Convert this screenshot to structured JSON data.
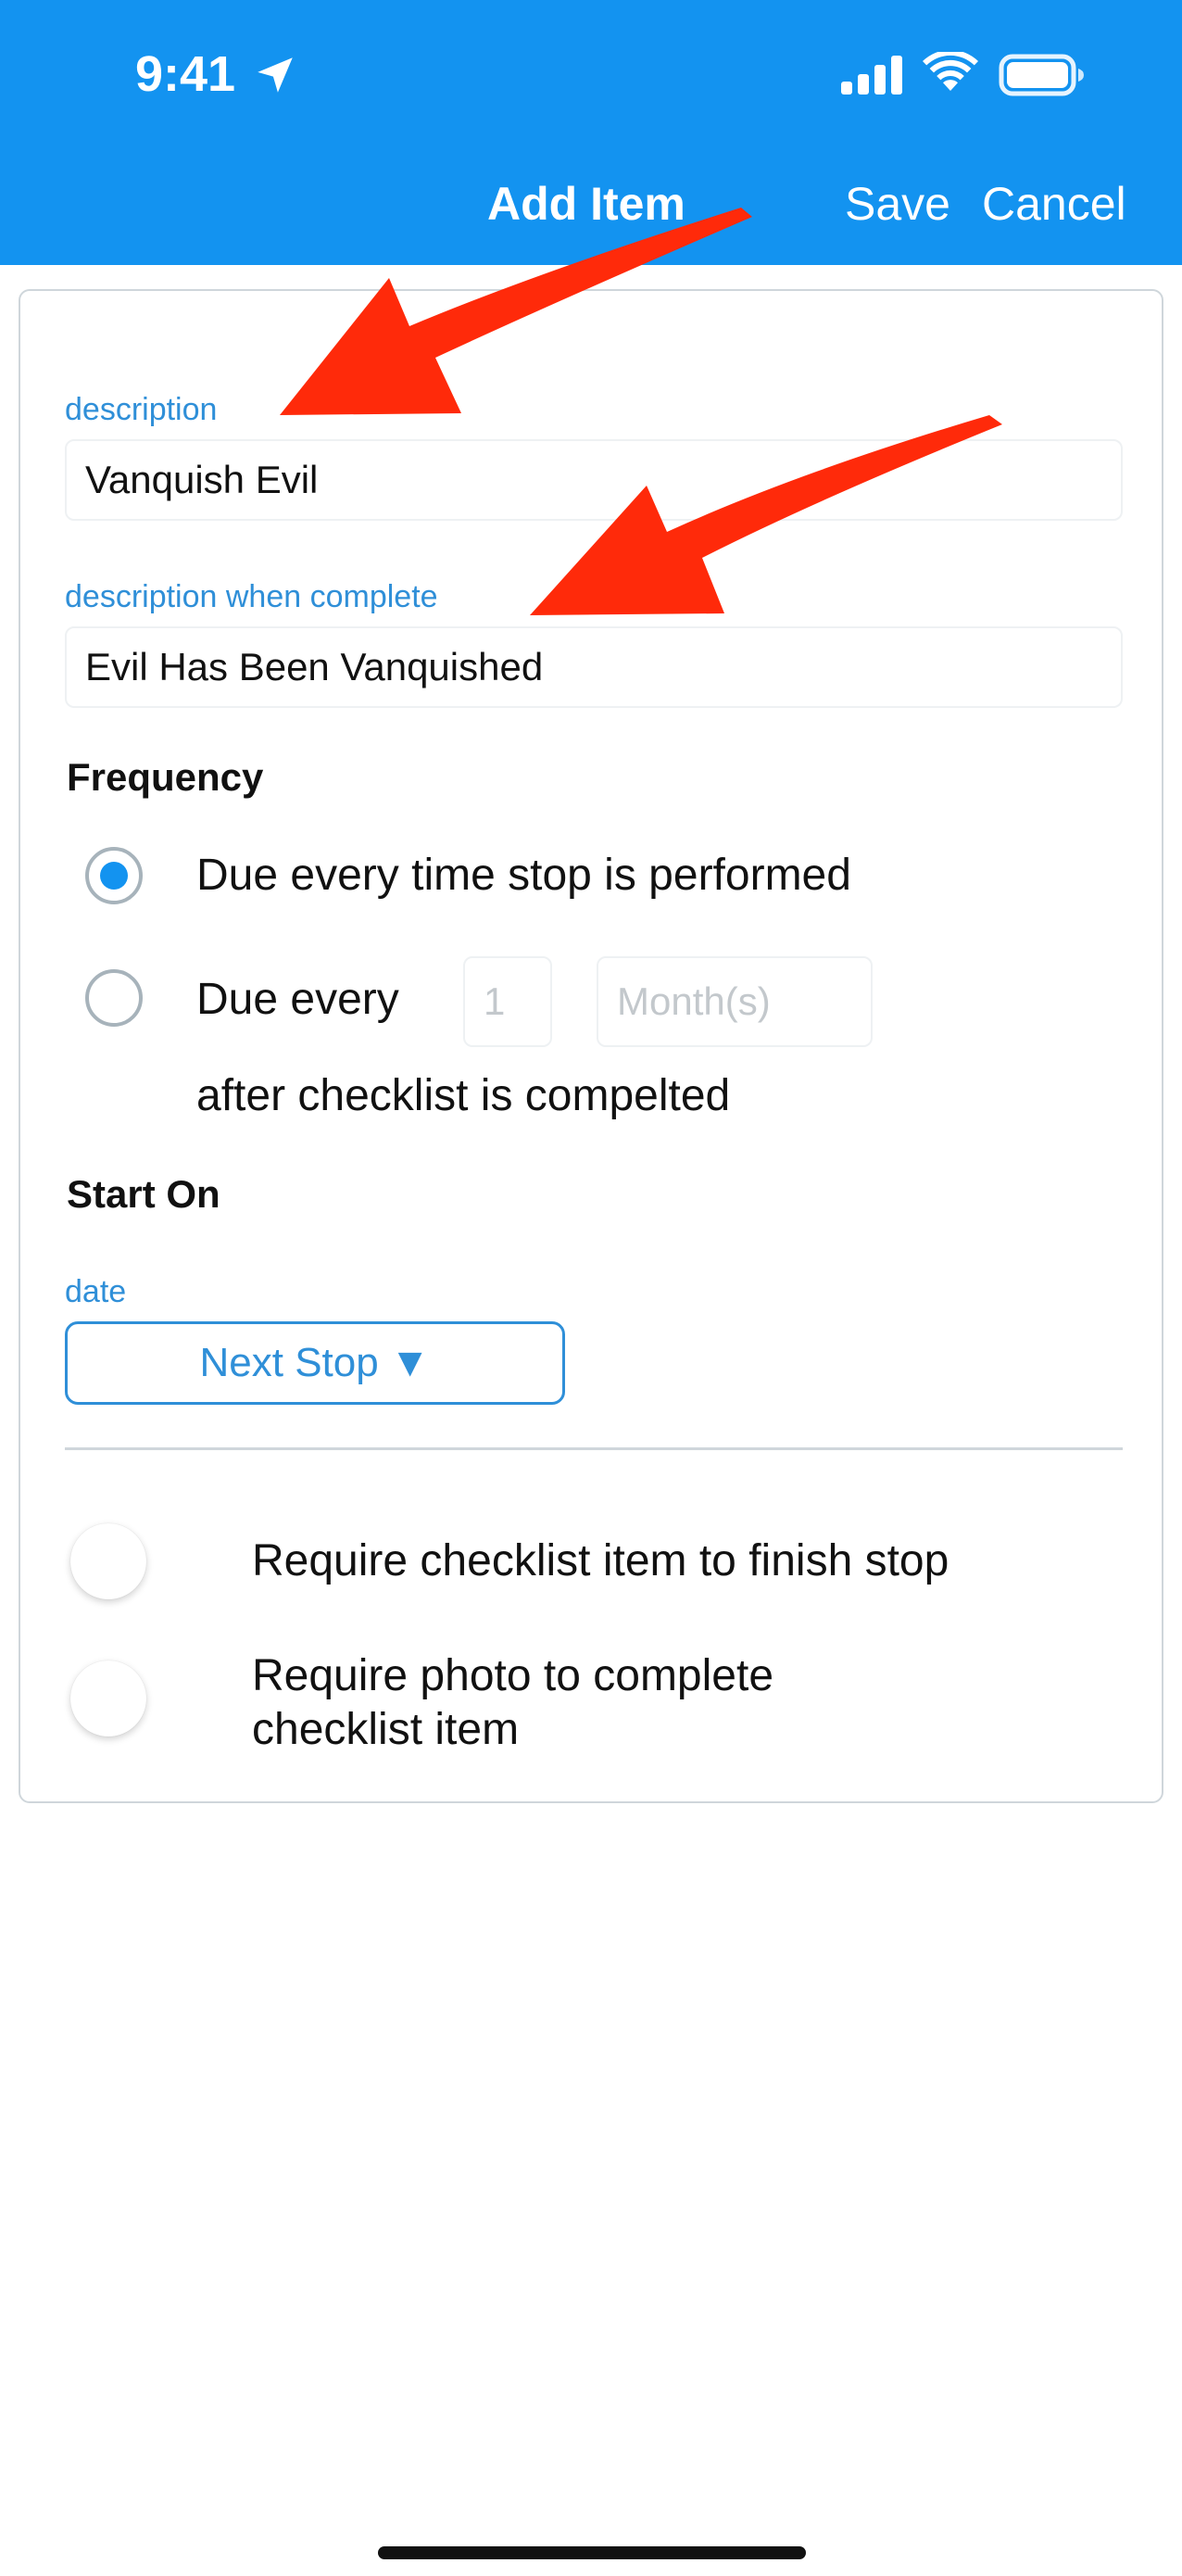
{
  "status_bar": {
    "time": "9:41"
  },
  "nav": {
    "title": "Add Item",
    "save_label": "Save",
    "cancel_label": "Cancel"
  },
  "form": {
    "description_label": "description",
    "description_value": "Vanquish Evil",
    "description_complete_label": "description when complete",
    "description_complete_value": "Evil Has Been Vanquished",
    "frequency": {
      "title": "Frequency",
      "option_every_stop": "Due every time stop is performed",
      "option_every_stop_selected": true,
      "option_interval_prefix": "Due every",
      "interval_placeholder": "1",
      "unit_placeholder": "Month(s)",
      "option_interval_suffix": "after checklist is compelted"
    },
    "start_on": {
      "title": "Start On",
      "date_label": "date",
      "date_button": "Next Stop ▼"
    },
    "toggles": {
      "require_item_label": "Require checklist item to finish stop",
      "require_photo_label": "Require photo to complete checklist item"
    }
  },
  "colors": {
    "header_bg": "#1393f0",
    "accent": "#2f8fd8",
    "arrow": "#ff2a0a"
  }
}
